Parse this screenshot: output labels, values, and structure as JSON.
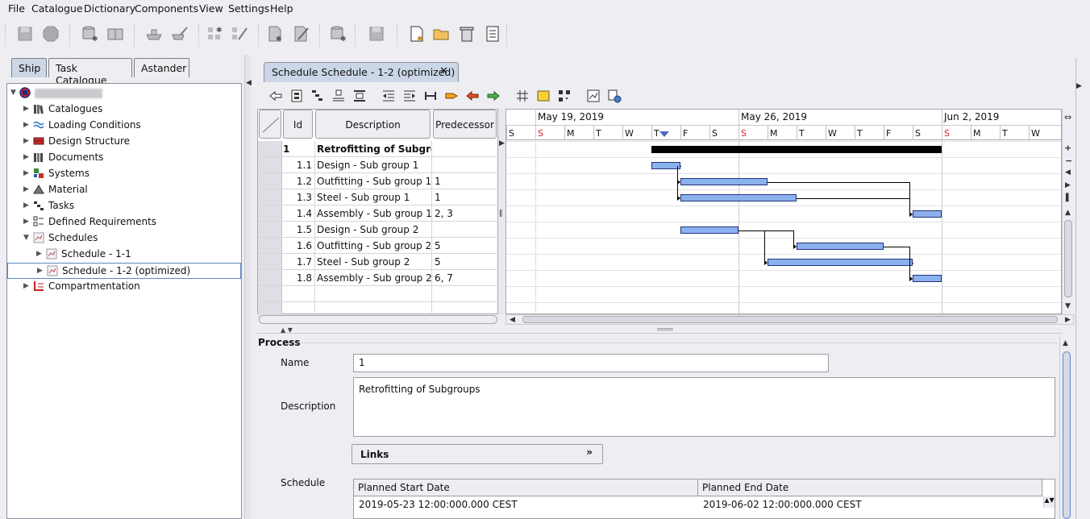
{
  "menu": [
    "File",
    "Catalogue",
    "Dictionary",
    "Components",
    "View",
    "Settings",
    "Help"
  ],
  "left_tabs": [
    "Ship",
    "Task Catalogue",
    "Astander"
  ],
  "tree": {
    "root_label": "",
    "items": [
      {
        "label": "Catalogues",
        "icon": "catalogue-books-icon",
        "expanded": false
      },
      {
        "label": "Loading Conditions",
        "icon": "waves-icon",
        "expanded": false
      },
      {
        "label": "Design Structure",
        "icon": "design-structure-icon",
        "expanded": false
      },
      {
        "label": "Documents",
        "icon": "documents-icon",
        "expanded": false
      },
      {
        "label": "Systems",
        "icon": "systems-icon",
        "expanded": false
      },
      {
        "label": "Material",
        "icon": "material-icon",
        "expanded": false
      },
      {
        "label": "Tasks",
        "icon": "tasks-icon",
        "expanded": false
      },
      {
        "label": "Defined Requirements",
        "icon": "requirements-icon",
        "expanded": false
      },
      {
        "label": "Schedules",
        "icon": "schedule-icon",
        "expanded": true
      },
      {
        "label": "Schedule - 1-1",
        "icon": "schedule-icon",
        "expanded": false,
        "child": true
      },
      {
        "label": "Schedule - 1-2 (optimized)",
        "icon": "schedule-icon",
        "expanded": false,
        "child": true,
        "selected": true
      },
      {
        "label": "Compartmentation",
        "icon": "compartment-icon",
        "expanded": false
      }
    ]
  },
  "document_tab": {
    "label": "Schedule Schedule - 1-2 (optimized)",
    "close": "✕"
  },
  "table": {
    "headers": {
      "id": "Id",
      "description": "Description",
      "predecessor": "Predecessor"
    },
    "rows": [
      {
        "id": "1",
        "description": "Retrofitting of Subgroups",
        "predecessor": "",
        "bold": true
      },
      {
        "id": "1.1",
        "description": "Design - Sub group 1",
        "predecessor": ""
      },
      {
        "id": "1.2",
        "description": "Outfitting - Sub group 1",
        "predecessor": "1"
      },
      {
        "id": "1.3",
        "description": "Steel - Sub group 1",
        "predecessor": "1"
      },
      {
        "id": "1.4",
        "description": "Assembly - Sub group 1",
        "predecessor": "2, 3"
      },
      {
        "id": "1.5",
        "description": "Design - Sub group 2",
        "predecessor": ""
      },
      {
        "id": "1.6",
        "description": "Outfitting - Sub group 2",
        "predecessor": "5"
      },
      {
        "id": "1.7",
        "description": "Steel - Sub group 2",
        "predecessor": "5"
      },
      {
        "id": "1.8",
        "description": "Assembly - Sub group 2",
        "predecessor": "6, 7"
      }
    ]
  },
  "gantt": {
    "weeks": [
      "May 19, 2019",
      "May 26, 2019",
      "Jun 2, 2019"
    ],
    "day_letters": [
      "S",
      "S",
      "M",
      "T",
      "W",
      "T",
      "F",
      "S",
      "S",
      "M",
      "T",
      "W",
      "T",
      "F",
      "S",
      "S",
      "M",
      "T",
      "W"
    ],
    "sunday_indices": [
      1,
      8,
      15
    ],
    "bars": [
      {
        "row": 0,
        "start": 5.0,
        "end": 15.0,
        "summary": true
      },
      {
        "row": 1,
        "start": 5.0,
        "end": 6.0
      },
      {
        "row": 2,
        "start": 6.0,
        "end": 9.0
      },
      {
        "row": 3,
        "start": 6.0,
        "end": 10.0
      },
      {
        "row": 4,
        "start": 14.0,
        "end": 15.0
      },
      {
        "row": 5,
        "start": 6.0,
        "end": 8.0
      },
      {
        "row": 6,
        "start": 10.0,
        "end": 13.0
      },
      {
        "row": 7,
        "start": 9.0,
        "end": 14.0
      },
      {
        "row": 8,
        "start": 14.0,
        "end": 15.0
      }
    ]
  },
  "process": {
    "section_title": "Process",
    "name_label": "Name",
    "name_value": "1",
    "description_label": "Description",
    "description_value": "Retrofitting of Subgroups",
    "links_label": "Links",
    "schedule_label": "Schedule",
    "schedule_headers": [
      "Planned Start Date",
      "Planned End Date"
    ],
    "schedule_values": [
      "2019-05-23 12:00:000.000 CEST",
      "2019-06-02 12:00:000.000 CEST"
    ]
  },
  "colors": {
    "accent_tab": "#cbd6e6",
    "bar_fill": "#8bb1ef",
    "sunday_red": "#e02020"
  }
}
